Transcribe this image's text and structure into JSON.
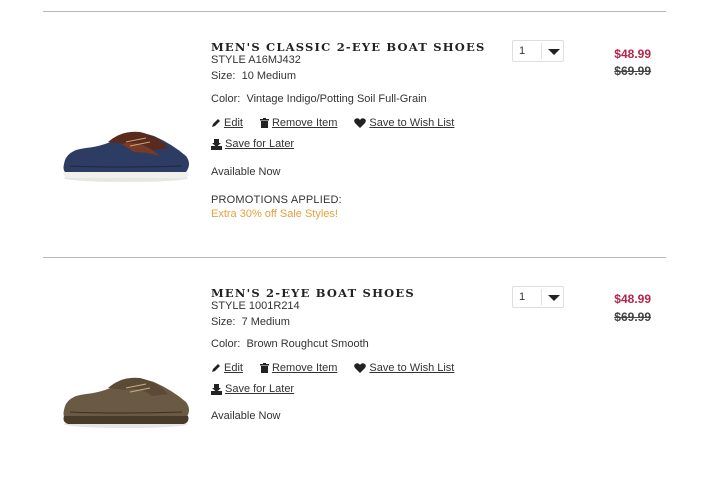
{
  "cart": {
    "actions": {
      "edit": "Edit",
      "remove": "Remove Item",
      "wishlist": "Save to Wish List",
      "save_later": "Save for Later"
    },
    "items": [
      {
        "title": "MEN'S CLASSIC 2-EYE BOAT SHOES",
        "style": "STYLE A16MJ432",
        "size_label": "Size:",
        "size": "10 Medium",
        "color_label": "Color:",
        "color": "Vintage Indigo/Potting Soil Full-Grain",
        "availability": "Available Now",
        "promotions_heading": "PROMOTIONS APPLIED:",
        "promotion": "Extra 30% off Sale Styles!",
        "quantity": "1",
        "sale_price": "$48.99",
        "original_price": "$69.99",
        "image_icon": "navy-brown-boat-shoe-image"
      },
      {
        "title": "MEN'S 2-EYE BOAT SHOES",
        "style": "STYLE 1001R214",
        "size_label": "Size:",
        "size": "7 Medium",
        "color_label": "Color:",
        "color": "Brown Roughcut Smooth",
        "availability": "Available Now",
        "quantity": "1",
        "sale_price": "$48.99",
        "original_price": "$69.99",
        "image_icon": "brown-boat-shoe-image"
      }
    ]
  },
  "colors": {
    "sale_price": "#b8234a",
    "promotion": "#e5a13b",
    "divider": "#b8b8b8"
  }
}
